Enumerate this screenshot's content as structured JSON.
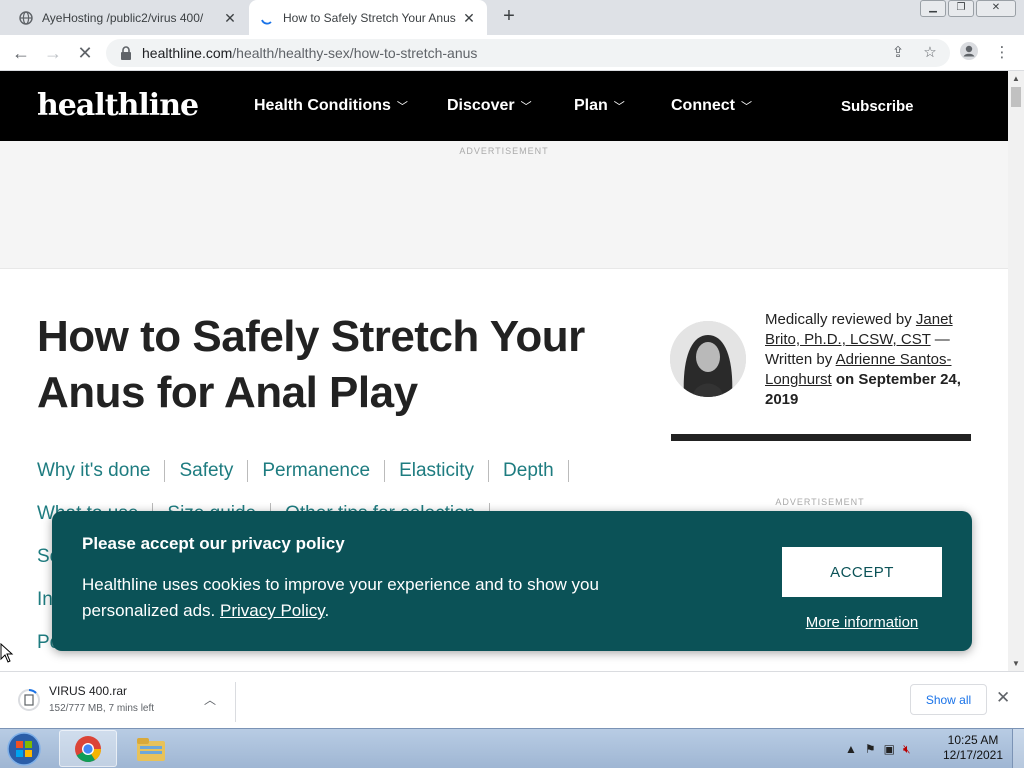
{
  "browser": {
    "tabs": [
      {
        "title": "AyeHosting /public2/virus 400/",
        "icon": "globe-icon"
      },
      {
        "title": "How to Safely Stretch Your Anus",
        "icon": "loading-spinner-icon"
      }
    ],
    "url_host": "healthline.com",
    "url_path": "/health/healthy-sex/how-to-stretch-anus"
  },
  "site": {
    "logo": "healthline",
    "menu": [
      "Health Conditions",
      "Discover",
      "Plan",
      "Connect"
    ],
    "subscribe": "Subscribe",
    "ad_label": "ADVERTISEMENT"
  },
  "article": {
    "title": "How to Safely Stretch Your Anus for Anal Play",
    "byline": {
      "reviewed_prefix": "Medically reviewed by ",
      "reviewer": "Janet Brito, Ph.D., LCSW, CST",
      "written_prefix": " — Written by ",
      "author": "Adrienne Santos-Longhurst",
      "date_prefix": " on ",
      "date": "September 24, 2019"
    },
    "toc_row1": [
      "Why it's done",
      "Safety",
      "Permanence",
      "Elasticity",
      "Depth"
    ],
    "toc_row2": [
      "What to use",
      "Size guide",
      "Other tips for selection"
    ],
    "toc_partial": [
      "Se",
      "In",
      "Po"
    ],
    "side_ad_label": "ADVERTISEMENT"
  },
  "cookie": {
    "title": "Please accept our privacy policy",
    "text": "Healthline uses cookies to improve your experience and to show you personalized ads. ",
    "policy_link": "Privacy Policy",
    "text_end": ".",
    "accept": "ACCEPT",
    "more": "More information",
    "bg_color": "#0b5257"
  },
  "downloads": {
    "file_name": "VIRUS 400.rar",
    "status": "152/777 MB, 7 mins left",
    "show_all": "Show all"
  },
  "taskbar": {
    "time": "10:25 AM",
    "date": "12/17/2021"
  }
}
